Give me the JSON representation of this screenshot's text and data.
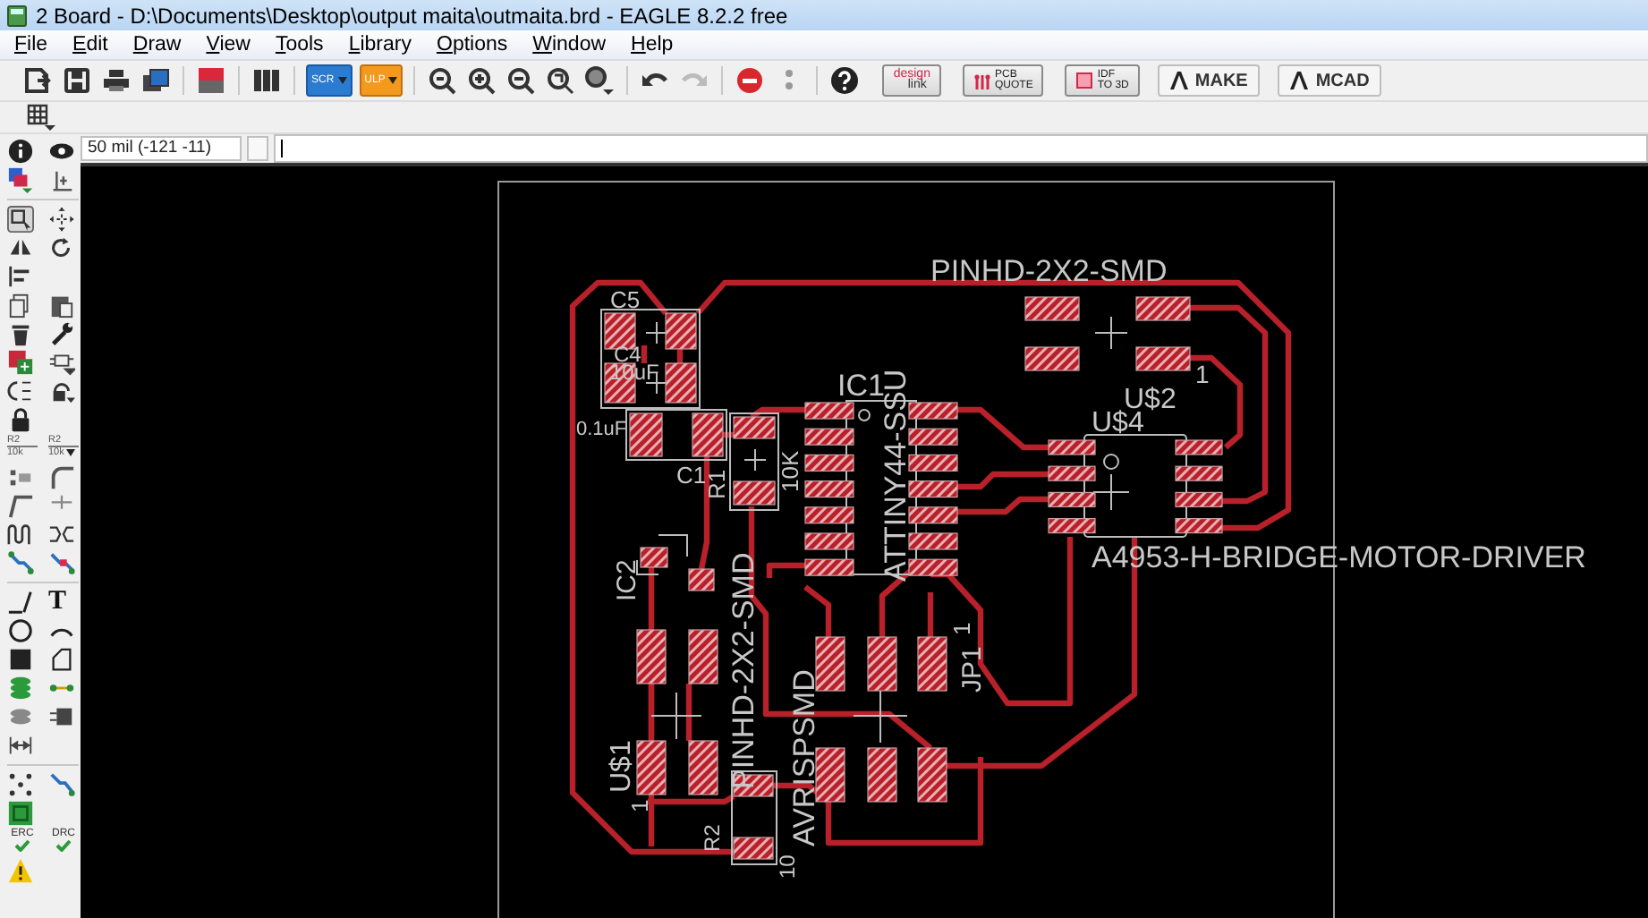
{
  "window": {
    "title": "2 Board - D:\\Documents\\Desktop\\output maita\\outmaita.brd - EAGLE 8.2.2 free"
  },
  "menu": [
    "File",
    "Edit",
    "Draw",
    "View",
    "Tools",
    "Library",
    "Options",
    "Window",
    "Help"
  ],
  "toolbar": {
    "script_label": "SCR",
    "ulp_label": "ULP",
    "design_link": [
      "design",
      "link"
    ],
    "pcb_quote": [
      "PCB",
      "QUOTE"
    ],
    "idf": [
      "IDF",
      "TO 3D"
    ],
    "make": "MAKE",
    "mcad": "MCAD"
  },
  "coordinates": "50 mil (-121 -11)",
  "left_toolbar": {
    "name_tool": [
      "R2",
      "10k"
    ],
    "value_tool": [
      "R2",
      "10k"
    ],
    "text_tool": "T",
    "erc": "ERC",
    "drc": "DRC"
  },
  "board_labels": [
    {
      "text": "PINHD-2X2-SMD",
      "kind": "h"
    },
    {
      "text": "C5",
      "kind": "h"
    },
    {
      "text": "C4",
      "kind": "h"
    },
    {
      "text": "10uF",
      "kind": "h"
    },
    {
      "text": "0.1uF",
      "kind": "h"
    },
    {
      "text": "C1",
      "kind": "h"
    },
    {
      "text": "R1",
      "kind": "v"
    },
    {
      "text": "10K",
      "kind": "v"
    },
    {
      "text": "IC1",
      "kind": "h"
    },
    {
      "text": "ATTINY44-SSU",
      "kind": "v"
    },
    {
      "text": "U$2",
      "kind": "h"
    },
    {
      "text": "U$4",
      "kind": "h"
    },
    {
      "text": "1",
      "kind": "h"
    },
    {
      "text": "A4953-H-BRIDGE-MOTOR-DRIVER",
      "kind": "h"
    },
    {
      "text": "IC2",
      "kind": "v"
    },
    {
      "text": "PINHD-2X2-SMD",
      "kind": "v"
    },
    {
      "text": "AVRISPSMD",
      "kind": "v"
    },
    {
      "text": "1",
      "kind": "v"
    },
    {
      "text": "JP1",
      "kind": "v"
    },
    {
      "text": "U$1",
      "kind": "v"
    },
    {
      "text": "1",
      "kind": "v"
    },
    {
      "text": "R2",
      "kind": "v"
    },
    {
      "text": "10",
      "kind": "v"
    }
  ]
}
